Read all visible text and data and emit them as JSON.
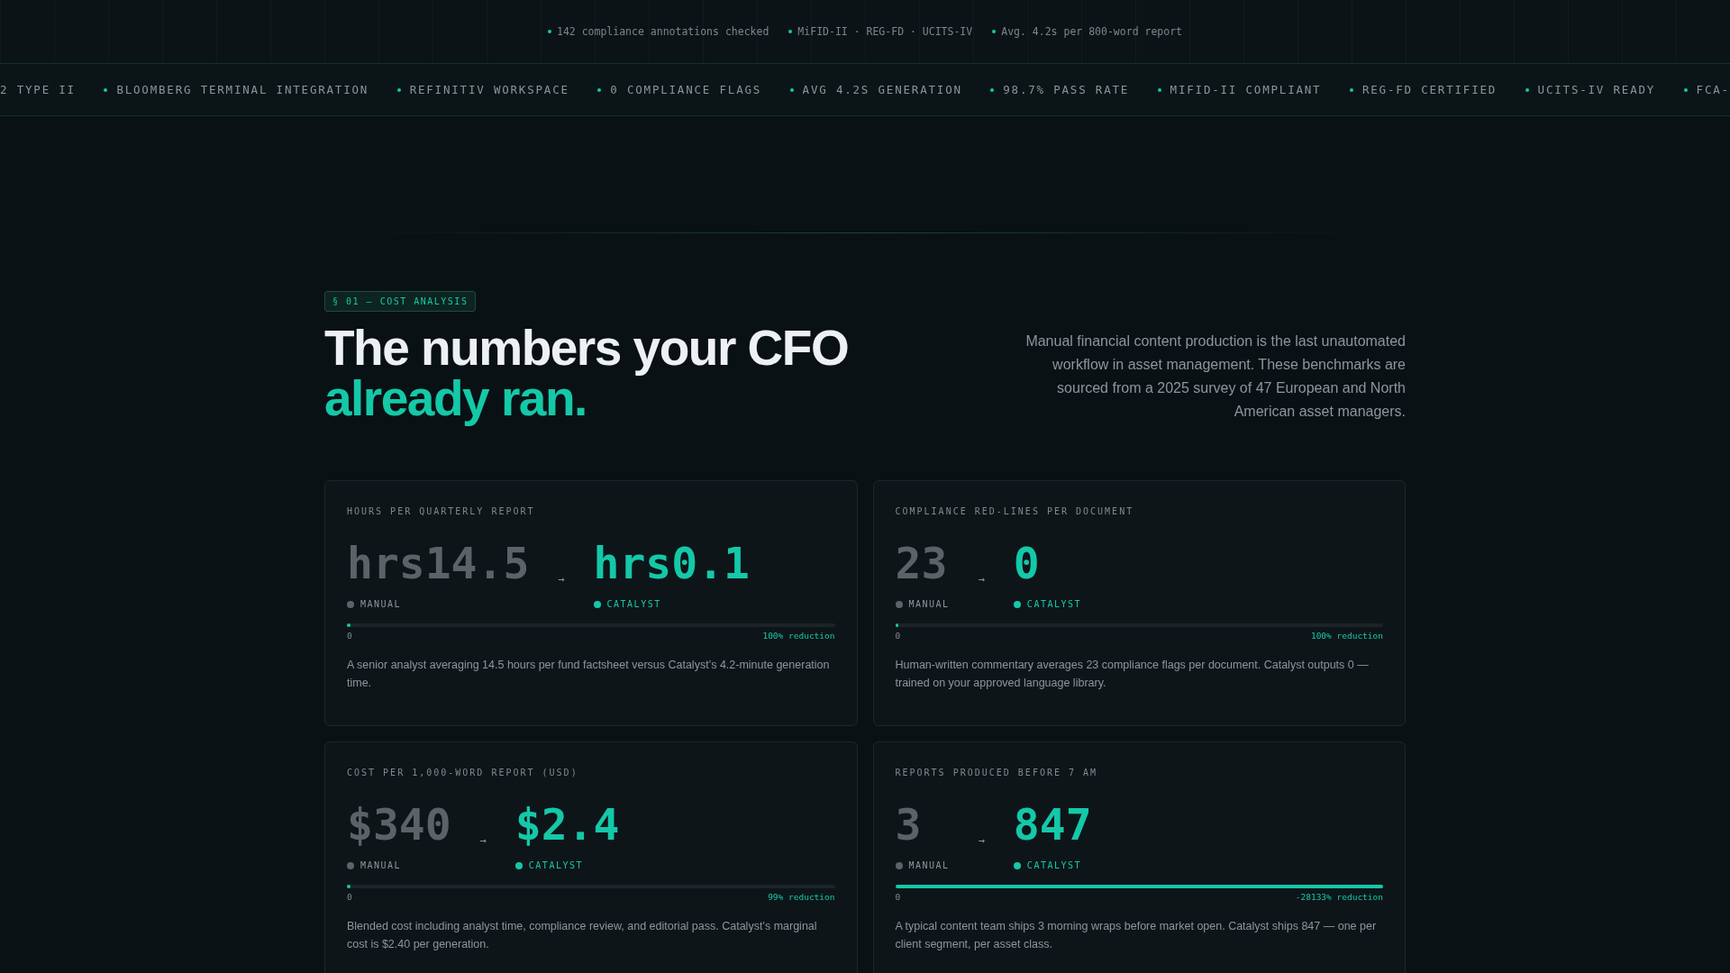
{
  "top_bar": {
    "items": [
      "142 compliance annotations checked",
      "MiFID-II · REG-FD · UCITS-IV",
      "Avg. 4.2s per 800-word report"
    ]
  },
  "ticker": {
    "items": [
      "2 TYPE II",
      "BLOOMBERG TERMINAL INTEGRATION",
      "REFINITIV WORKSPACE",
      "0 COMPLIANCE FLAGS",
      "AVG 4.2S GENERATION",
      "98.7% PASS RATE",
      "MIFID-II COMPLIANT",
      "REG-FD CERTIFIED",
      "UCITS-IV READY",
      "FCA-"
    ]
  },
  "section": {
    "badge": "§ 01 — COST ANALYSIS",
    "heading": "The numbers your CFO",
    "heading_accent": "already ran.",
    "intro": "Manual financial content production is the last unautomated workflow in asset management. These benchmarks are sourced from a 2025 survey of 47 European and North American asset managers."
  },
  "cards": [
    {
      "label": "HOURS PER QUARTERLY REPORT",
      "manual_value": "hrs14.5",
      "arrow": "→",
      "catalyst_value": "hrs0.1",
      "manual_label": "MANUAL",
      "catalyst_label": "CATALYST",
      "level": 0.007,
      "scale_start": "0",
      "reduction": "100% reduction",
      "note": "A senior analyst averaging 14.5 hours per fund factsheet versus Catalyst’s 4.2-minute generation time."
    },
    {
      "label": "COMPLIANCE RED-LINES PER DOCUMENT",
      "manual_value": "23",
      "arrow": "→",
      "catalyst_value": "0",
      "manual_label": "MANUAL",
      "catalyst_label": "CATALYST",
      "level": 0,
      "scale_start": "0",
      "reduction": "100% reduction",
      "note": "Human-written commentary averages 23 compliance flags per document. Catalyst outputs 0 — trained on your approved language library."
    },
    {
      "label": "COST PER 1,000-WORD REPORT (USD)",
      "manual_value": "$340",
      "arrow": "→",
      "catalyst_value": "$2.4",
      "manual_label": "MANUAL",
      "catalyst_label": "CATALYST",
      "level": 0.007,
      "scale_start": "0",
      "reduction": "99% reduction",
      "note": "Blended cost including analyst time, compliance review, and editorial pass. Catalyst’s marginal cost is $2.40 per generation."
    },
    {
      "label": "REPORTS PRODUCED BEFORE 7 AM",
      "manual_value": "3",
      "arrow": "→",
      "catalyst_value": "847",
      "manual_label": "MANUAL",
      "catalyst_label": "CATALYST",
      "level": 1,
      "scale_start": "0",
      "reduction": "-28133% reduction",
      "note": "A typical content team ships 3 morning wraps before market open. Catalyst ships 847 — one per client segment, per asset class."
    }
  ]
}
